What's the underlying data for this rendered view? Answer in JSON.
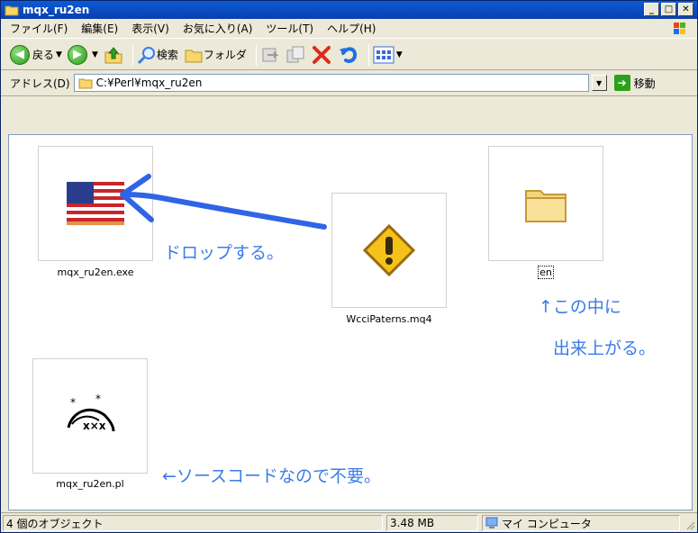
{
  "window": {
    "title": "mqx_ru2en"
  },
  "menu": [
    "ファイル(F)",
    "編集(E)",
    "表示(V)",
    "お気に入り(A)",
    "ツール(T)",
    "ヘルプ(H)"
  ],
  "toolbar": {
    "back_label": "戻る",
    "search_label": "検索",
    "folder_label": "フォルダ"
  },
  "address": {
    "label": "アドレス(D)",
    "value": "C:¥Perl¥mqx_ru2en",
    "go_label": "移動"
  },
  "files": [
    {
      "name": "mqx_ru2en.exe",
      "icon": "us-flag-icon"
    },
    {
      "name": "WcciPaterns.mq4",
      "icon": "warning-icon"
    },
    {
      "name": "en",
      "icon": "folder-icon"
    },
    {
      "name": "mqx_ru2en.pl",
      "icon": "script-icon"
    }
  ],
  "annotations": {
    "drop": "ドロップする。",
    "inside_line1": "↑この中に",
    "inside_line2": "出来上がる。",
    "source": "←ソースコードなので不要。"
  },
  "status": {
    "objects": "4 個のオブジェクト",
    "size": "3.48 MB",
    "location": "マイ コンピュータ"
  },
  "colors": {
    "titlebar": "#0a46c4",
    "annotation": "#3a7bea",
    "arrow": "#2f64e6"
  }
}
